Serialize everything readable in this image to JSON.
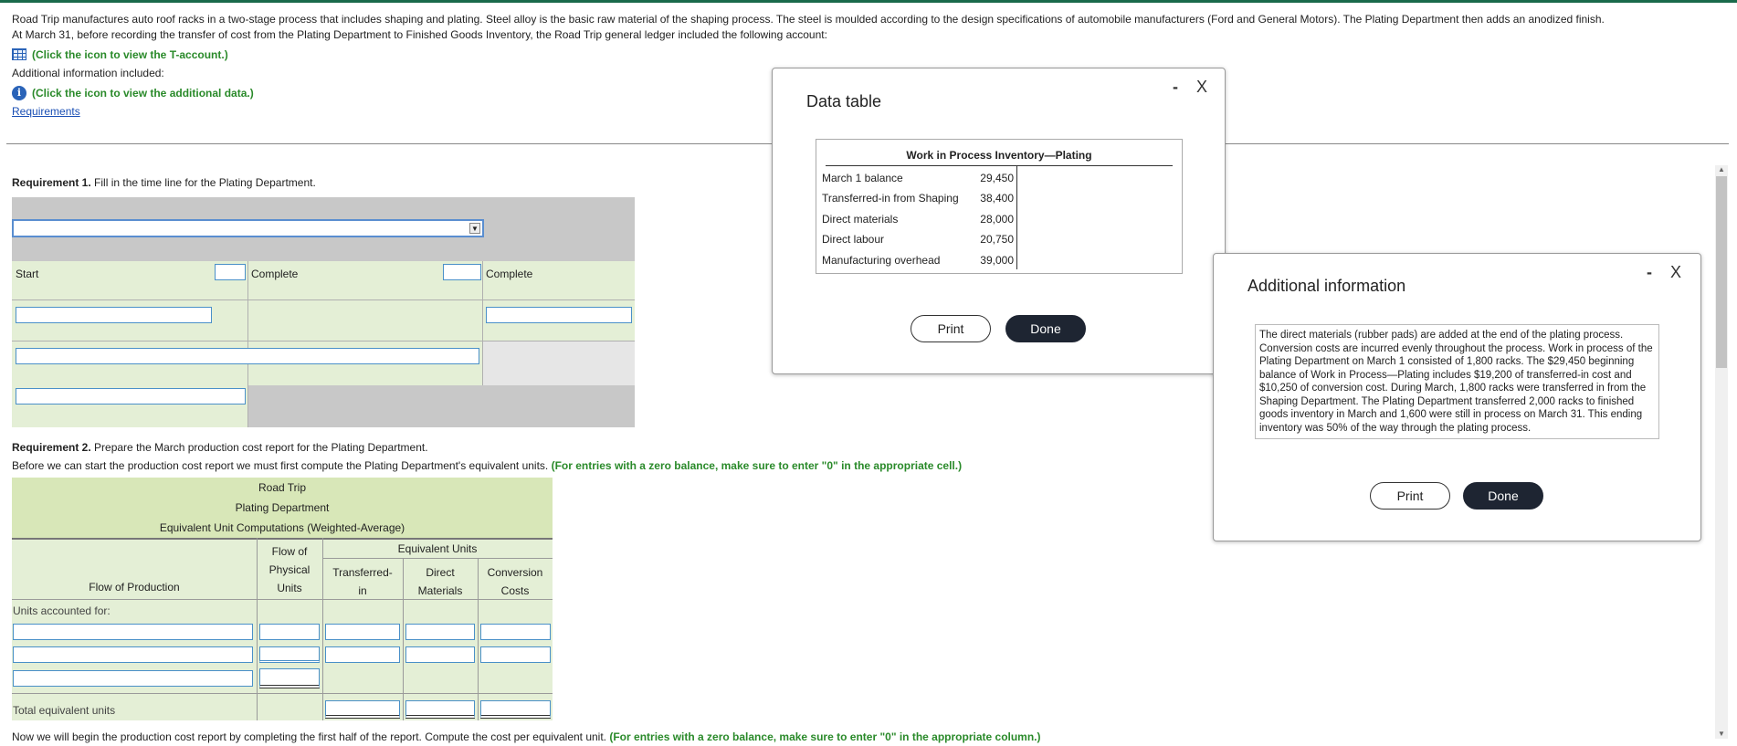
{
  "intro": {
    "line1": "Road Trip manufactures auto roof racks in a two-stage process that includes shaping and plating. Steel alloy is the basic raw material of the shaping process. The steel is moulded according to the design specifications of automobile manufacturers (Ford and General Motors). The Plating Department then adds an anodized finish.",
    "line2": "At March 31, before recording the transfer of cost from the Plating Department to Finished Goods Inventory, the Road Trip general ledger included the following account:",
    "taccount_link": "(Click the icon to view the T-account.)",
    "additional_label": "Additional information included:",
    "additional_link": "(Click the icon to view the additional data.)",
    "requirements_link": "Requirements"
  },
  "req1": {
    "bold": "Requirement 1.",
    "text": " Fill in the time line for the Plating Department.",
    "start_label": "Start",
    "complete_label_1": "Complete",
    "complete_label_2": "Complete"
  },
  "req2": {
    "bold": "Requirement 2.",
    "text": " Prepare the March production cost report for the Plating Department.",
    "line2": "Before we can start the production cost report we must first compute the Plating Department's equivalent units.",
    "line2_green": "(For entries with a zero balance, make sure to enter \"0\" in the appropriate cell.)"
  },
  "eu_table": {
    "company": "Road Trip",
    "department": "Plating Department",
    "subtitle": "Equivalent Unit Computations (Weighted-Average)",
    "col_flow_production": "Flow of Production",
    "col_flow_physical": [
      "Flow of",
      "Physical",
      "Units"
    ],
    "col_equivalent_units": "Equivalent Units",
    "col_transferred": [
      "Transferred-",
      "in"
    ],
    "col_direct": [
      "Direct",
      "Materials"
    ],
    "col_conversion": [
      "Conversion",
      "Costs"
    ],
    "units_accounted": "Units accounted for:",
    "total_eu": "Total equivalent units"
  },
  "bottom": {
    "text": "Now we will begin the production cost report by completing the first half of the report. Compute the cost per equivalent unit.",
    "green": "(For entries with a zero balance, make sure to enter \"0\" in the appropriate column.)"
  },
  "data_table_dialog": {
    "title": "Data table",
    "minimize": "-",
    "close": "X",
    "account_title": "Work in Process Inventory—Plating",
    "rows": [
      {
        "label": "March 1 balance",
        "value": "29,450"
      },
      {
        "label": "Transferred-in from Shaping",
        "value": "38,400"
      },
      {
        "label": "Direct materials",
        "value": "28,000"
      },
      {
        "label": "Direct labour",
        "value": "20,750"
      },
      {
        "label": "Manufacturing overhead",
        "value": "39,000"
      }
    ],
    "print": "Print",
    "done": "Done"
  },
  "additional_dialog": {
    "title": "Additional information",
    "minimize": "-",
    "close": "X",
    "text": "The direct materials (rubber pads) are added at the end of the plating process. Conversion costs are incurred evenly throughout the process. Work in process of the Plating Department on March 1 consisted of 1,800 racks. The $29,450 beginning balance of Work in Process—Plating includes $19,200 of transferred-in cost and $10,250 of conversion cost. During March, 1,800 racks were transferred in from the Shaping Department. The Plating Department transferred 2,000 racks to finished goods inventory in March and 1,600 were still in process on March 31. This ending inventory was 50% of the way through the plating process.",
    "print": "Print",
    "done": "Done"
  }
}
